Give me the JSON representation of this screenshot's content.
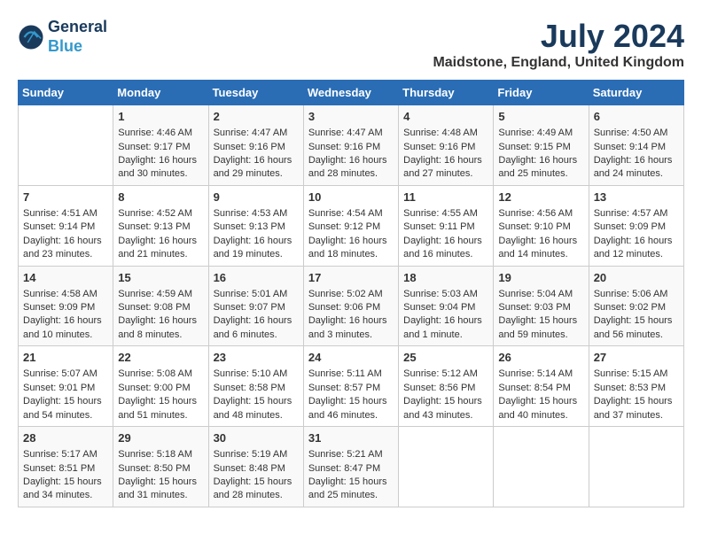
{
  "header": {
    "logo_line1": "General",
    "logo_line2": "Blue",
    "month_year": "July 2024",
    "location": "Maidstone, England, United Kingdom"
  },
  "days_of_week": [
    "Sunday",
    "Monday",
    "Tuesday",
    "Wednesday",
    "Thursday",
    "Friday",
    "Saturday"
  ],
  "weeks": [
    [
      {
        "day": "",
        "info": ""
      },
      {
        "day": "1",
        "info": "Sunrise: 4:46 AM\nSunset: 9:17 PM\nDaylight: 16 hours\nand 30 minutes."
      },
      {
        "day": "2",
        "info": "Sunrise: 4:47 AM\nSunset: 9:16 PM\nDaylight: 16 hours\nand 29 minutes."
      },
      {
        "day": "3",
        "info": "Sunrise: 4:47 AM\nSunset: 9:16 PM\nDaylight: 16 hours\nand 28 minutes."
      },
      {
        "day": "4",
        "info": "Sunrise: 4:48 AM\nSunset: 9:16 PM\nDaylight: 16 hours\nand 27 minutes."
      },
      {
        "day": "5",
        "info": "Sunrise: 4:49 AM\nSunset: 9:15 PM\nDaylight: 16 hours\nand 25 minutes."
      },
      {
        "day": "6",
        "info": "Sunrise: 4:50 AM\nSunset: 9:14 PM\nDaylight: 16 hours\nand 24 minutes."
      }
    ],
    [
      {
        "day": "7",
        "info": "Sunrise: 4:51 AM\nSunset: 9:14 PM\nDaylight: 16 hours\nand 23 minutes."
      },
      {
        "day": "8",
        "info": "Sunrise: 4:52 AM\nSunset: 9:13 PM\nDaylight: 16 hours\nand 21 minutes."
      },
      {
        "day": "9",
        "info": "Sunrise: 4:53 AM\nSunset: 9:13 PM\nDaylight: 16 hours\nand 19 minutes."
      },
      {
        "day": "10",
        "info": "Sunrise: 4:54 AM\nSunset: 9:12 PM\nDaylight: 16 hours\nand 18 minutes."
      },
      {
        "day": "11",
        "info": "Sunrise: 4:55 AM\nSunset: 9:11 PM\nDaylight: 16 hours\nand 16 minutes."
      },
      {
        "day": "12",
        "info": "Sunrise: 4:56 AM\nSunset: 9:10 PM\nDaylight: 16 hours\nand 14 minutes."
      },
      {
        "day": "13",
        "info": "Sunrise: 4:57 AM\nSunset: 9:09 PM\nDaylight: 16 hours\nand 12 minutes."
      }
    ],
    [
      {
        "day": "14",
        "info": "Sunrise: 4:58 AM\nSunset: 9:09 PM\nDaylight: 16 hours\nand 10 minutes."
      },
      {
        "day": "15",
        "info": "Sunrise: 4:59 AM\nSunset: 9:08 PM\nDaylight: 16 hours\nand 8 minutes."
      },
      {
        "day": "16",
        "info": "Sunrise: 5:01 AM\nSunset: 9:07 PM\nDaylight: 16 hours\nand 6 minutes."
      },
      {
        "day": "17",
        "info": "Sunrise: 5:02 AM\nSunset: 9:06 PM\nDaylight: 16 hours\nand 3 minutes."
      },
      {
        "day": "18",
        "info": "Sunrise: 5:03 AM\nSunset: 9:04 PM\nDaylight: 16 hours\nand 1 minute."
      },
      {
        "day": "19",
        "info": "Sunrise: 5:04 AM\nSunset: 9:03 PM\nDaylight: 15 hours\nand 59 minutes."
      },
      {
        "day": "20",
        "info": "Sunrise: 5:06 AM\nSunset: 9:02 PM\nDaylight: 15 hours\nand 56 minutes."
      }
    ],
    [
      {
        "day": "21",
        "info": "Sunrise: 5:07 AM\nSunset: 9:01 PM\nDaylight: 15 hours\nand 54 minutes."
      },
      {
        "day": "22",
        "info": "Sunrise: 5:08 AM\nSunset: 9:00 PM\nDaylight: 15 hours\nand 51 minutes."
      },
      {
        "day": "23",
        "info": "Sunrise: 5:10 AM\nSunset: 8:58 PM\nDaylight: 15 hours\nand 48 minutes."
      },
      {
        "day": "24",
        "info": "Sunrise: 5:11 AM\nSunset: 8:57 PM\nDaylight: 15 hours\nand 46 minutes."
      },
      {
        "day": "25",
        "info": "Sunrise: 5:12 AM\nSunset: 8:56 PM\nDaylight: 15 hours\nand 43 minutes."
      },
      {
        "day": "26",
        "info": "Sunrise: 5:14 AM\nSunset: 8:54 PM\nDaylight: 15 hours\nand 40 minutes."
      },
      {
        "day": "27",
        "info": "Sunrise: 5:15 AM\nSunset: 8:53 PM\nDaylight: 15 hours\nand 37 minutes."
      }
    ],
    [
      {
        "day": "28",
        "info": "Sunrise: 5:17 AM\nSunset: 8:51 PM\nDaylight: 15 hours\nand 34 minutes."
      },
      {
        "day": "29",
        "info": "Sunrise: 5:18 AM\nSunset: 8:50 PM\nDaylight: 15 hours\nand 31 minutes."
      },
      {
        "day": "30",
        "info": "Sunrise: 5:19 AM\nSunset: 8:48 PM\nDaylight: 15 hours\nand 28 minutes."
      },
      {
        "day": "31",
        "info": "Sunrise: 5:21 AM\nSunset: 8:47 PM\nDaylight: 15 hours\nand 25 minutes."
      },
      {
        "day": "",
        "info": ""
      },
      {
        "day": "",
        "info": ""
      },
      {
        "day": "",
        "info": ""
      }
    ]
  ]
}
